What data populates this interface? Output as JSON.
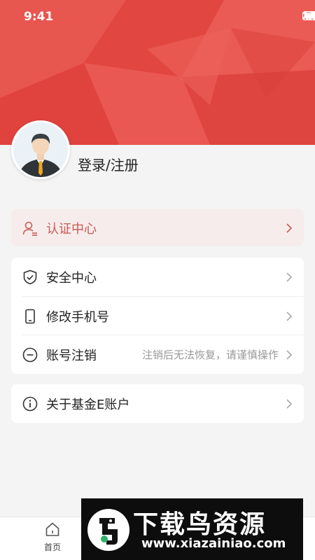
{
  "status_bar": {
    "time": "9:41"
  },
  "profile": {
    "login_label": "登录/注册"
  },
  "certification": {
    "label": "认证中心"
  },
  "menu": [
    {
      "icon": "shield-check-icon",
      "label": "安全中心",
      "hint": ""
    },
    {
      "icon": "phone-icon",
      "label": "修改手机号",
      "hint": ""
    },
    {
      "icon": "minus-circle-icon",
      "label": "账号注销",
      "hint": "注销后无法恢复，请谨慎操作"
    }
  ],
  "about": {
    "icon": "info-icon",
    "label": "关于基金E账户"
  },
  "tabbar": {
    "home_label": "首页"
  },
  "watermark": {
    "title": "下载鸟资源",
    "url": "www.xiazainiao.com"
  },
  "colors": {
    "banner": "#e64b45",
    "cert_text": "#c85a52",
    "cert_bg": "#f7ecec"
  }
}
